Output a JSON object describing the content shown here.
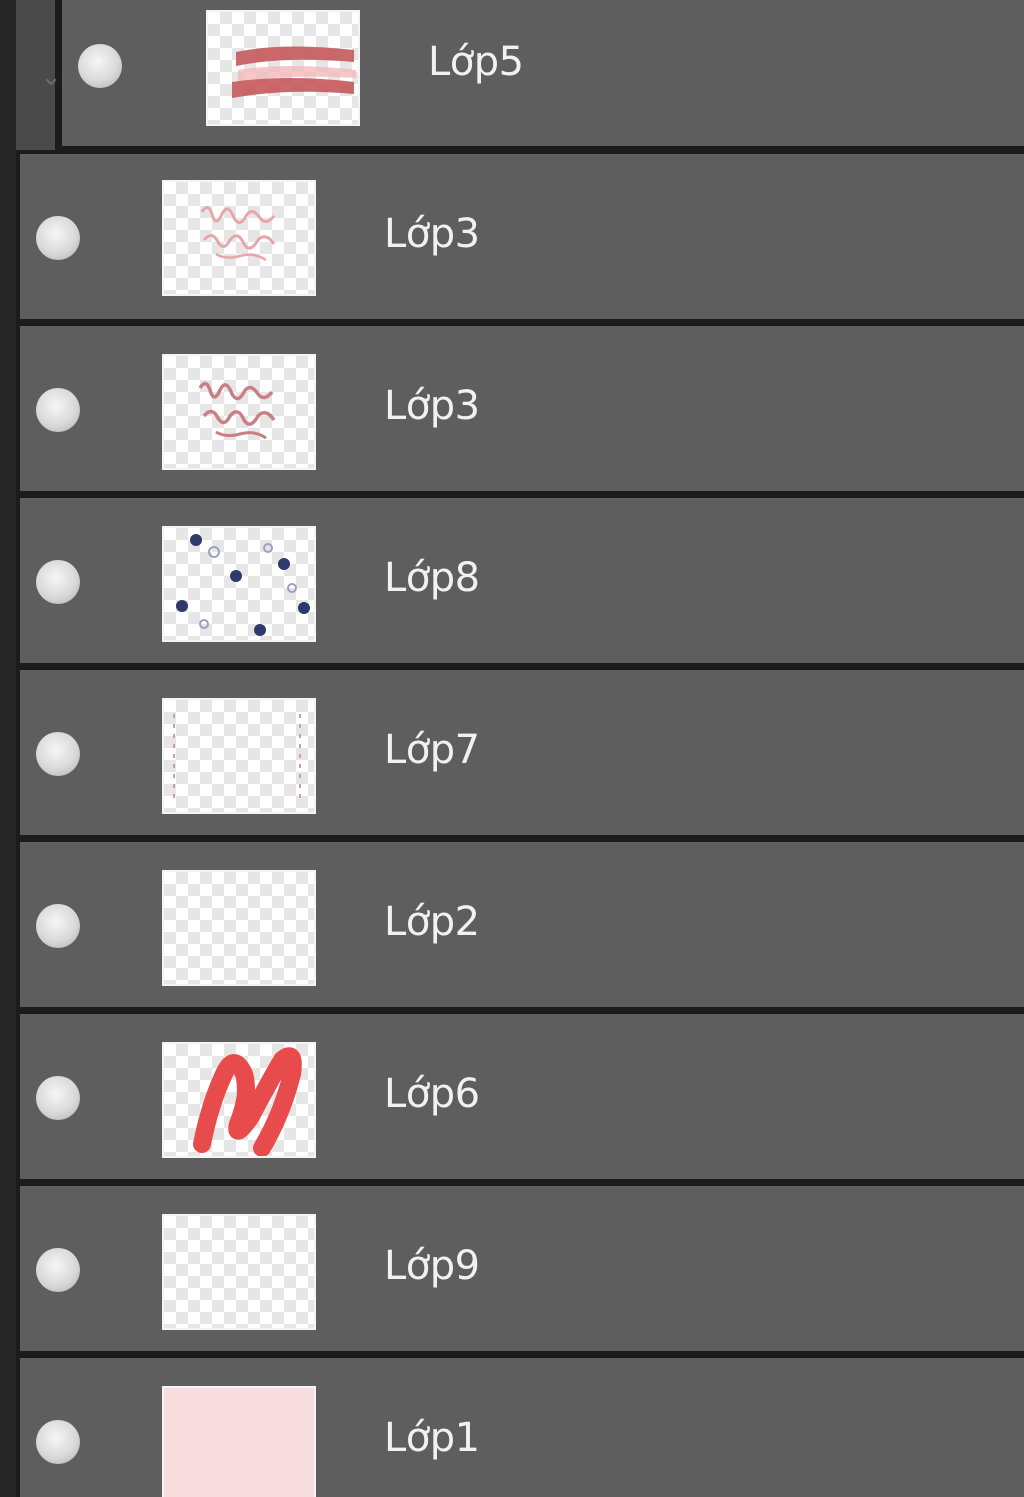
{
  "panel": {
    "title": ""
  },
  "group": {
    "collapse_icon": "chevron-down-icon"
  },
  "layers": [
    {
      "name": "Lớp5",
      "visible": true,
      "thumbnail": "red-stripes"
    },
    {
      "name": "Lớp3",
      "visible": true,
      "thumbnail": "pink-handwriting-light"
    },
    {
      "name": "Lớp3",
      "visible": true,
      "thumbnail": "pink-handwriting-dark"
    },
    {
      "name": "Lớp8",
      "visible": true,
      "thumbnail": "navy-dots"
    },
    {
      "name": "Lớp7",
      "visible": true,
      "thumbnail": "faint-border-marks"
    },
    {
      "name": "Lớp2",
      "visible": true,
      "thumbnail": "empty-transparent"
    },
    {
      "name": "Lớp6",
      "visible": true,
      "thumbnail": "red-scribble"
    },
    {
      "name": "Lớp9",
      "visible": true,
      "thumbnail": "empty-transparent"
    },
    {
      "name": "Lớp1",
      "visible": true,
      "thumbnail": "solid-pink-fill"
    }
  ],
  "colors": {
    "row_bg": "#5e5e5e",
    "separator": "#1c1c1c",
    "label_text": "#f1f1f1",
    "accent_red": "#e84b4b",
    "stripe_red": "#c4585a",
    "dot_navy": "#2d3a6a",
    "fill_pink": "#f9dedf"
  }
}
